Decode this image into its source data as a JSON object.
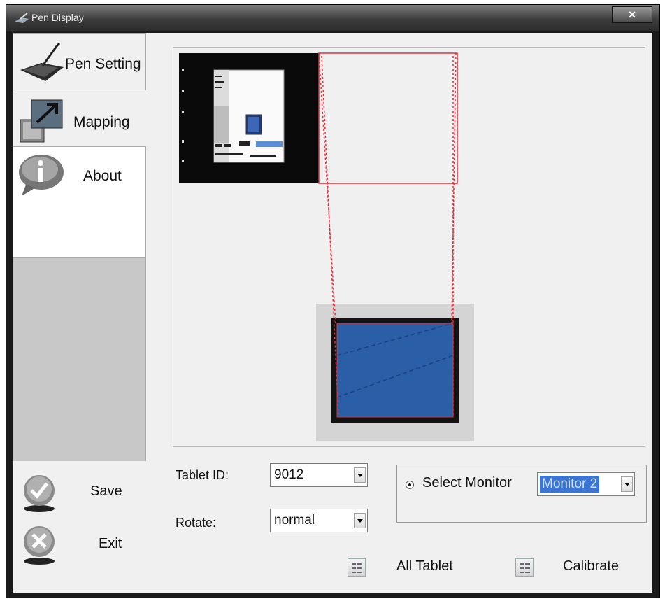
{
  "window": {
    "title": "Pen Display",
    "close_label": "×"
  },
  "sidebar": {
    "items": [
      {
        "label": "Pen Setting"
      },
      {
        "label": "Mapping"
      },
      {
        "label": "About"
      }
    ],
    "actions": [
      {
        "label": "Save"
      },
      {
        "label": "Exit"
      }
    ]
  },
  "settings": {
    "tablet_id_label": "Tablet ID:",
    "tablet_id_value": "9012",
    "rotate_label": "Rotate:",
    "rotate_value": "normal"
  },
  "monitor": {
    "option_label": "Select Monitor",
    "selected": "Monitor 2"
  },
  "buttons": {
    "all_tablet": "All Tablet",
    "calibrate": "Calibrate"
  },
  "colors": {
    "mapping_line": "#e0303a",
    "selection_blue": "#3875d7",
    "tablet_screen": "#2a5fa8"
  },
  "icons": {
    "title": "pen-tablet-icon",
    "pen_setting": "pen-tablet-icon",
    "mapping": "mapping-arrow-icon",
    "about": "info-bubble-icon",
    "save": "checkmark-circle-icon",
    "exit": "x-circle-icon",
    "list": "checklist-icon"
  }
}
